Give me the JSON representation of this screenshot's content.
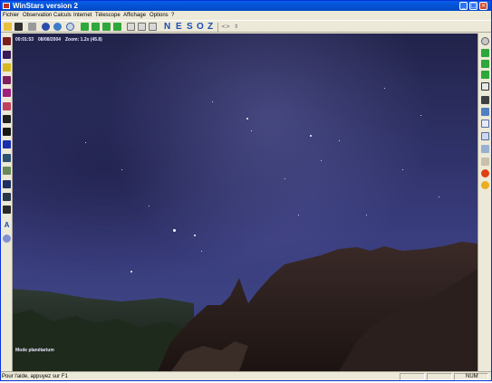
{
  "window": {
    "title": "WinStars version 2",
    "minimize_glyph": "_",
    "maximize_glyph": "□",
    "close_glyph": "×",
    "titlebar_color": "#0453d6"
  },
  "menu": {
    "items": [
      "Fichier",
      "Observation",
      "Calculs",
      "Internet",
      "Télescope",
      "Affichage",
      "Options",
      "?"
    ]
  },
  "toolbar": {
    "icons": [
      "open-folder-icon",
      "save-icon",
      "print-icon",
      "globe-icon",
      "earth-icon",
      "clock-icon",
      "nav-left-green-icon",
      "nav-up-green-icon",
      "nav-down-green-icon",
      "nav-right-green-icon",
      "zoom-in-icon",
      "zoom-out-icon",
      "zoom-fit-icon"
    ],
    "directions": [
      "N",
      "E",
      "S",
      "O",
      "Z"
    ],
    "scroll_left": "<",
    "scroll_right": ">",
    "extra_arrow": "⇕"
  },
  "left_toolbar": {
    "icons": [
      "constellation-icon",
      "galaxy-icon",
      "star-icon",
      "comet-icon",
      "nebula-icon",
      "meteor-icon",
      "satellite-icon",
      "planet-icon",
      "planet-blue-icon",
      "horizon-icon",
      "landscape-icon",
      "grid-icon",
      "grid-alt-icon",
      "line-icon"
    ],
    "text_tool": "A",
    "last_icon": "telescope-icon"
  },
  "right_toolbar": {
    "icons": [
      "zoom-magnifier-icon",
      "play-back-icon",
      "stop-icon",
      "play-icon",
      "pointer-icon",
      "binoculars-icon",
      "monitor-icon",
      "document-icon",
      "info-icon",
      "camera-icon",
      "image-icon",
      "sun-icon",
      "face-icon"
    ]
  },
  "sky": {
    "time": "00:01:53",
    "date": "08/08/2004",
    "zoom_label": "Zoom: 1.2x (45.8)",
    "mode": "Mode planétarium"
  },
  "status": {
    "help_text": "Pour l'aide, appuyez sur F1",
    "num": "NUM"
  }
}
